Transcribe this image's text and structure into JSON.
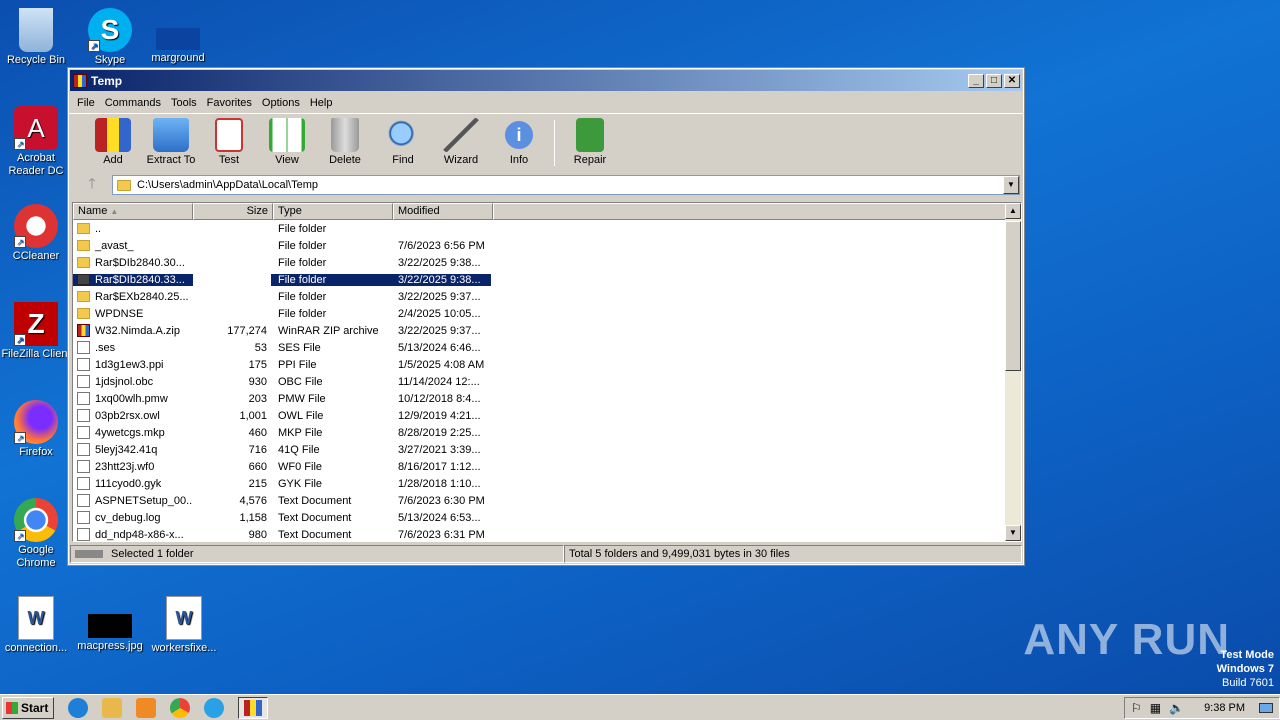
{
  "desktop": {
    "icons": [
      {
        "label": "Recycle Bin"
      },
      {
        "label": "Skype"
      },
      {
        "label": "marground"
      },
      {
        "label": "Acrobat Reader DC"
      },
      {
        "label": "CCleaner"
      },
      {
        "label": "FileZilla Client"
      },
      {
        "label": "Firefox"
      },
      {
        "label": "Google Chrome"
      },
      {
        "label": "connection..."
      },
      {
        "label": "macpress.jpg"
      },
      {
        "label": "workersfixe..."
      }
    ],
    "watermark": "ANY RUN",
    "test_mode": {
      "line1": "Test Mode",
      "line2": "Windows 7",
      "line3": "Build 7601"
    }
  },
  "window": {
    "title": "Temp",
    "menu": [
      "File",
      "Commands",
      "Tools",
      "Favorites",
      "Options",
      "Help"
    ],
    "toolbar": [
      "Add",
      "Extract To",
      "Test",
      "View",
      "Delete",
      "Find",
      "Wizard",
      "Info",
      "Repair"
    ],
    "address": "C:\\Users\\admin\\AppData\\Local\\Temp",
    "columns": {
      "name": "Name",
      "size": "Size",
      "type": "Type",
      "modified": "Modified"
    },
    "rows": [
      {
        "name": "..",
        "size": "",
        "type": "File folder",
        "modified": ""
      },
      {
        "name": "_avast_",
        "size": "",
        "type": "File folder",
        "modified": "7/6/2023 6:56 PM"
      },
      {
        "name": "Rar$DIb2840.30...",
        "size": "",
        "type": "File folder",
        "modified": "3/22/2025 9:38..."
      },
      {
        "name": "Rar$DIb2840.33...",
        "size": "",
        "type": "File folder",
        "modified": "3/22/2025 9:38..."
      },
      {
        "name": "Rar$EXb2840.25...",
        "size": "",
        "type": "File folder",
        "modified": "3/22/2025 9:37..."
      },
      {
        "name": "WPDNSE",
        "size": "",
        "type": "File folder",
        "modified": "2/4/2025 10:05..."
      },
      {
        "name": "W32.Nimda.A.zip",
        "size": "177,274",
        "type": "WinRAR ZIP archive",
        "modified": "3/22/2025 9:37..."
      },
      {
        "name": ".ses",
        "size": "53",
        "type": "SES File",
        "modified": "5/13/2024 6:46..."
      },
      {
        "name": "1d3g1ew3.ppi",
        "size": "175",
        "type": "PPI File",
        "modified": "1/5/2025 4:08 AM"
      },
      {
        "name": "1jdsjnol.obc",
        "size": "930",
        "type": "OBC File",
        "modified": "11/14/2024 12:..."
      },
      {
        "name": "1xq00wlh.pmw",
        "size": "203",
        "type": "PMW File",
        "modified": "10/12/2018 8:4..."
      },
      {
        "name": "03pb2rsx.owl",
        "size": "1,001",
        "type": "OWL File",
        "modified": "12/9/2019 4:21..."
      },
      {
        "name": "4ywetcgs.mkp",
        "size": "460",
        "type": "MKP File",
        "modified": "8/28/2019 2:25..."
      },
      {
        "name": "5leyj342.41q",
        "size": "716",
        "type": "41Q File",
        "modified": "3/27/2021 3:39..."
      },
      {
        "name": "23htt23j.wf0",
        "size": "660",
        "type": "WF0 File",
        "modified": "8/16/2017 1:12..."
      },
      {
        "name": "111cyod0.gyk",
        "size": "215",
        "type": "GYK File",
        "modified": "1/28/2018 1:10..."
      },
      {
        "name": "ASPNETSetup_00...",
        "size": "4,576",
        "type": "Text Document",
        "modified": "7/6/2023 6:30 PM"
      },
      {
        "name": "cv_debug.log",
        "size": "1,158",
        "type": "Text Document",
        "modified": "5/13/2024 6:53..."
      },
      {
        "name": "dd_ndp48-x86-x...",
        "size": "980",
        "type": "Text Document",
        "modified": "7/6/2023 6:31 PM"
      }
    ],
    "status_left": "Selected 1 folder",
    "status_right": "Total 5 folders and 9,499,031 bytes in 30 files"
  },
  "taskbar": {
    "start": "Start",
    "clock": "9:38 PM"
  }
}
